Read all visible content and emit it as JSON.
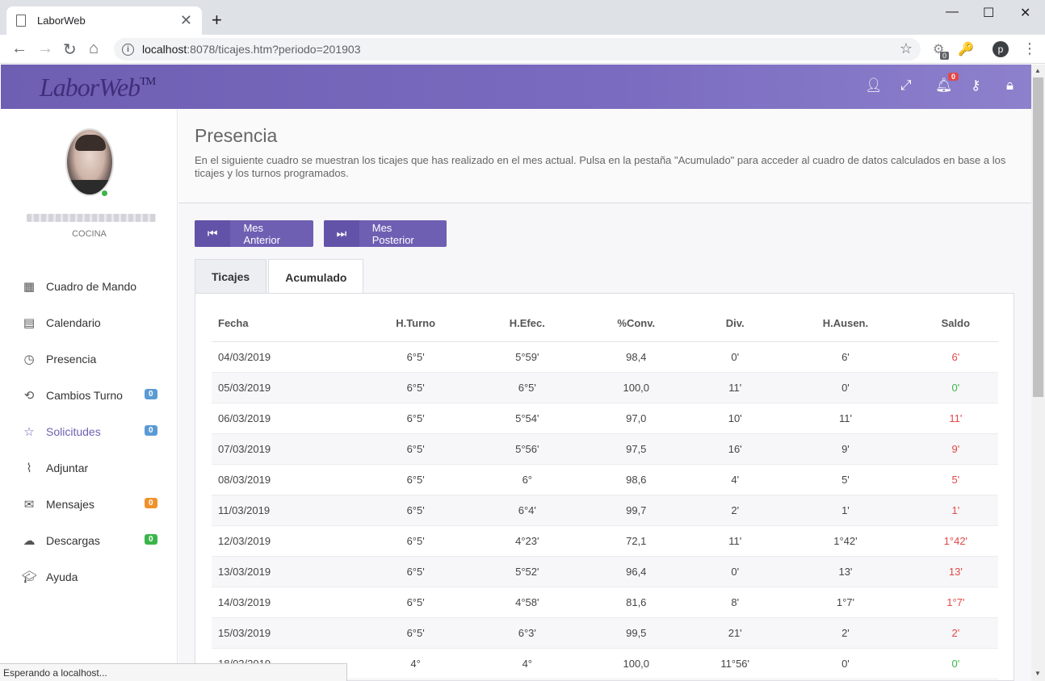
{
  "browser": {
    "tab_title": "LaborWeb",
    "url_host": "localhost",
    "url_rest": ":8078/ticajes.htm?periodo=201903",
    "ext_badge": "0",
    "profile_initial": "p",
    "status_text": "Esperando a localhost..."
  },
  "app": {
    "logo": "LaborWeb",
    "logo_tm": "TM",
    "notifications_count": "0"
  },
  "sidebar": {
    "department": "COCINA",
    "items": [
      {
        "label": "Cuadro de Mando",
        "icon": "grid-icon",
        "badge": ""
      },
      {
        "label": "Calendario",
        "icon": "calendar-icon",
        "badge": ""
      },
      {
        "label": "Presencia",
        "icon": "clock-icon",
        "badge": ""
      },
      {
        "label": "Cambios Turno",
        "icon": "refresh-icon",
        "badge": "0",
        "badge_color": "#5b9bd5"
      },
      {
        "label": "Solicitudes",
        "icon": "star-icon",
        "badge": "0",
        "badge_color": "#5b9bd5"
      },
      {
        "label": "Adjuntar",
        "icon": "paperclip-icon",
        "badge": ""
      },
      {
        "label": "Mensajes",
        "icon": "envelope-icon",
        "badge": "0",
        "badge_color": "#f0912b"
      },
      {
        "label": "Descargas",
        "icon": "cloud-download-icon",
        "badge": "0",
        "badge_color": "#3bb54a"
      },
      {
        "label": "Ayuda",
        "icon": "graduation-cap-icon",
        "badge": ""
      }
    ]
  },
  "page": {
    "title": "Presencia",
    "description": "En el siguiente cuadro se muestran los ticajes que has realizado en el mes actual. Pulsa en la pestaña \"Acumulado\" para acceder al cuadro de datos calculados en base a los ticajes y los turnos programados.",
    "prev_button": "Mes Anterior",
    "next_button": "Mes Posterior",
    "tabs": [
      "Ticajes",
      "Acumulado"
    ]
  },
  "table": {
    "headers": [
      "Fecha",
      "H.Turno",
      "H.Efec.",
      "%Conv.",
      "Div.",
      "H.Ausen.",
      "Saldo"
    ],
    "rows": [
      [
        "04/03/2019",
        "6°5'",
        "5°59'",
        "98,4",
        "0'",
        "6'",
        "6'"
      ],
      [
        "05/03/2019",
        "6°5'",
        "6°5'",
        "100,0",
        "11'",
        "0'",
        "0'"
      ],
      [
        "06/03/2019",
        "6°5'",
        "5°54'",
        "97,0",
        "10'",
        "11'",
        "11'"
      ],
      [
        "07/03/2019",
        "6°5'",
        "5°56'",
        "97,5",
        "16'",
        "9'",
        "9'"
      ],
      [
        "08/03/2019",
        "6°5'",
        "6°",
        "98,6",
        "4'",
        "5'",
        "5'"
      ],
      [
        "11/03/2019",
        "6°5'",
        "6°4'",
        "99,7",
        "2'",
        "1'",
        "1'"
      ],
      [
        "12/03/2019",
        "6°5'",
        "4°23'",
        "72,1",
        "11'",
        "1°42'",
        "1°42'"
      ],
      [
        "13/03/2019",
        "6°5'",
        "5°52'",
        "96,4",
        "0'",
        "13'",
        "13'"
      ],
      [
        "14/03/2019",
        "6°5'",
        "4°58'",
        "81,6",
        "8'",
        "1°7'",
        "1°7'"
      ],
      [
        "15/03/2019",
        "6°5'",
        "6°3'",
        "99,5",
        "21'",
        "2'",
        "2'"
      ],
      [
        "18/03/2019",
        "4°",
        "4°",
        "100,0",
        "11°56'",
        "0'",
        "0'"
      ]
    ],
    "saldo_status": [
      "neg",
      "pos",
      "neg",
      "neg",
      "neg",
      "neg",
      "neg",
      "neg",
      "neg",
      "neg",
      "pos"
    ]
  }
}
